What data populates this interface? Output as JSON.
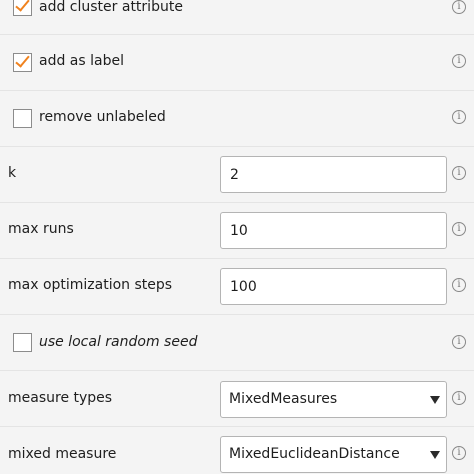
{
  "parameters": {
    "add_cluster_attribute": {
      "label": "add cluster attribute",
      "checked": true
    },
    "add_as_label": {
      "label": "add as label",
      "checked": true
    },
    "remove_unlabeled": {
      "label": "remove unlabeled",
      "checked": false
    },
    "k": {
      "label": "k",
      "value": "2"
    },
    "max_runs": {
      "label": "max runs",
      "value": "10"
    },
    "max_optimization_steps": {
      "label": "max optimization steps",
      "value": "100"
    },
    "use_local_random_seed": {
      "label": "use local random seed",
      "checked": false
    },
    "measure_types": {
      "label": "measure types",
      "selected": "MixedMeasures"
    },
    "mixed_measure": {
      "label": "mixed measure",
      "selected": "MixedEuclideanDistance"
    }
  },
  "info_icon_glyph": "i",
  "colors": {
    "checkmark": "#f0821e",
    "panel_background": "#f4f4f4",
    "field_border": "#b4b4b4"
  },
  "icons": [
    "checkbox-checked-icon",
    "info-icon",
    "dropdown-caret-icon"
  ]
}
